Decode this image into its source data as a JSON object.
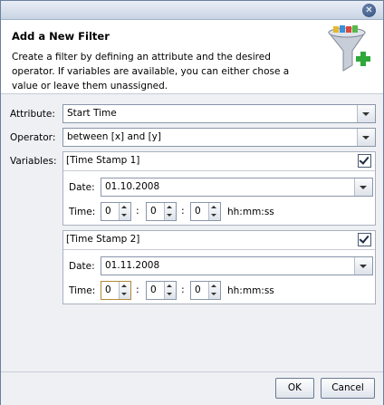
{
  "dialog": {
    "title": "Add a New Filter",
    "description": "Create a filter by defining an attribute and the desired operator. If variables are available, you can either chose a value or leave them unassigned."
  },
  "form": {
    "attribute_label": "Attribute:",
    "attribute_value": "Start Time",
    "operator_label": "Operator:",
    "operator_value": "between [x] and [y]",
    "variables_label": "Variables:"
  },
  "variables": [
    {
      "name": "[Time Stamp 1]",
      "checked": true,
      "date_label": "Date:",
      "date": "01.10.2008",
      "time_label": "Time:",
      "hours": "0",
      "minutes": "0",
      "seconds": "0",
      "format": "hh:mm:ss"
    },
    {
      "name": "[Time Stamp 2]",
      "checked": true,
      "date_label": "Date:",
      "date": "01.11.2008",
      "time_label": "Time:",
      "hours": "0",
      "minutes": "0",
      "seconds": "0",
      "format": "hh:mm:ss"
    }
  ],
  "separator": ":",
  "buttons": {
    "ok": "OK",
    "cancel": "Cancel"
  },
  "icons": {
    "close": "close-icon",
    "filter": "funnel-add-icon"
  }
}
